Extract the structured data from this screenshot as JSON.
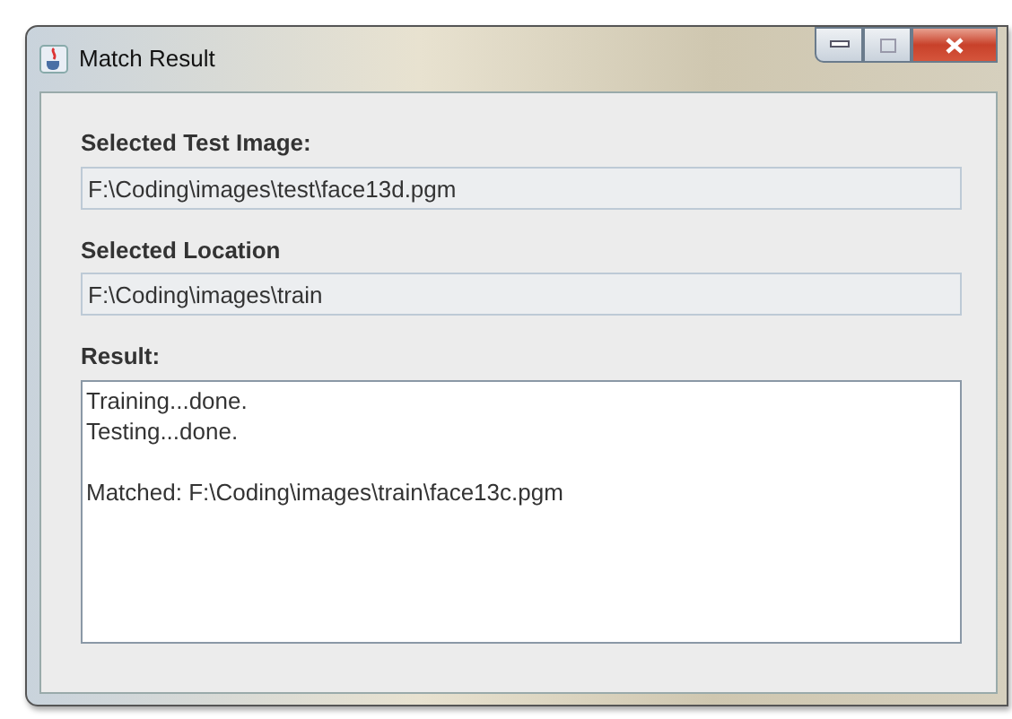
{
  "window": {
    "title": "Match Result"
  },
  "fields": [
    {
      "label": "Selected Test Image:",
      "value": "F:\\Coding\\images\\test\\face13d.pgm"
    },
    {
      "label": "Selected Location",
      "value": "F:\\Coding\\images\\train"
    }
  ],
  "result": {
    "label": "Result:",
    "paragraphs": [
      [
        "Training...done.",
        "Testing...done."
      ],
      [
        "Matched: F:\\Coding\\images\\train\\face13c.pgm"
      ]
    ]
  }
}
